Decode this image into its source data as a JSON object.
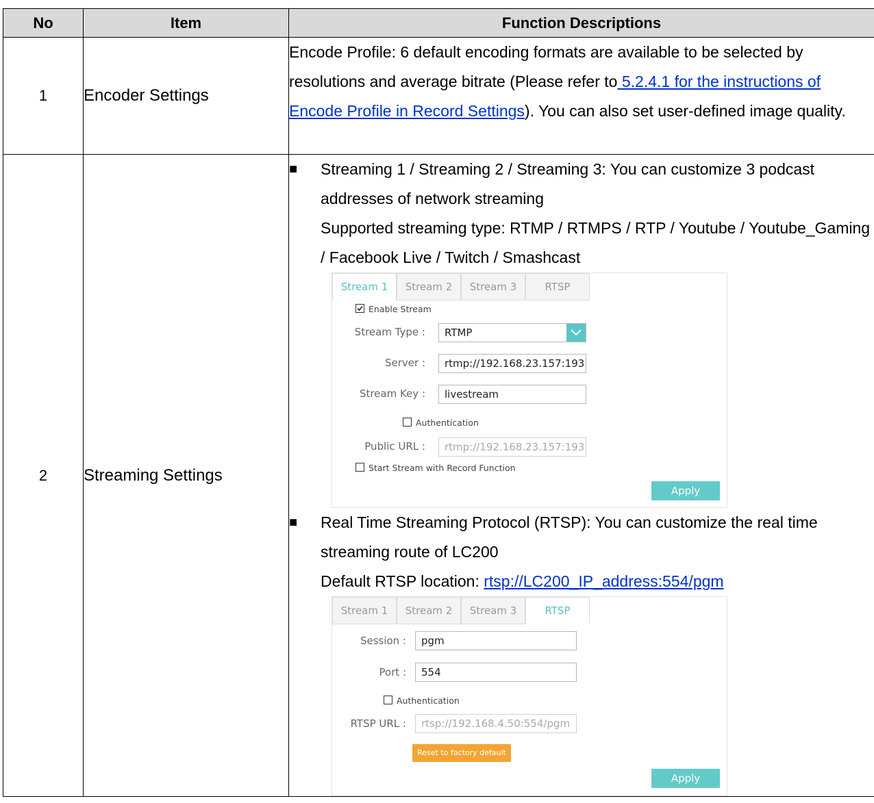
{
  "table": {
    "headers": [
      "No",
      "Item",
      "Function Descriptions"
    ],
    "row1": {
      "no": "1",
      "item": "Encoder Settings",
      "desc_a": "Encode Profile: 6 default encoding formats are available to be selected by resolutions and average bitrate (Please refer to",
      "desc_link": " 5.2.4.1 for the instructions of Encode Profile in Record Settings",
      "desc_b": "). You can also set user-defined image quality."
    },
    "row2": {
      "no": "2",
      "item": "Streaming Settings",
      "bullet": "■",
      "b1_line1": "Streaming 1 / Streaming 2 / Streaming 3: You can customize 3 podcast addresses of network streaming",
      "b1_line2": "Supported streaming type: RTMP / RTMPS / RTP / Youtube / Youtube_Gaming / Facebook Live / Twitch / Smashcast",
      "b2_line1": "Real Time Streaming Protocol (RTSP): You can customize the real time streaming route of LC200",
      "b2_label": "Default RTSP location: ",
      "b2_link": "rtsp://LC200_IP_address:554/pgm"
    }
  },
  "panel1": {
    "tabs": [
      "Stream 1",
      "Stream 2",
      "Stream 3",
      "RTSP"
    ],
    "enable_stream": "Enable Stream",
    "stream_type_label": "Stream Type :",
    "stream_type_value": "RTMP",
    "server_label": "Server :",
    "server_value": "rtmp://192.168.23.157:193",
    "stream_key_label": "Stream Key :",
    "stream_key_value": "livestream",
    "authentication": "Authentication",
    "public_url_label": "Public URL :",
    "public_url_value": "rtmp://192.168.23.157:193",
    "start_with_record": "Start Stream with Record Function",
    "apply": "Apply",
    "accent": "#5bc6c9"
  },
  "panel2": {
    "tabs": [
      "Stream 1",
      "Stream 2",
      "Stream 3",
      "RTSP"
    ],
    "session_label": "Session :",
    "session_value": "pgm",
    "port_label": "Port :",
    "port_value": "554",
    "authentication": "Authentication",
    "rtsp_url_label": "RTSP URL :",
    "rtsp_url_value": "rtsp://192.168.4.50:554/pgm",
    "reset": "Reset to factory default",
    "apply": "Apply",
    "reset_color": "#f3a533"
  }
}
